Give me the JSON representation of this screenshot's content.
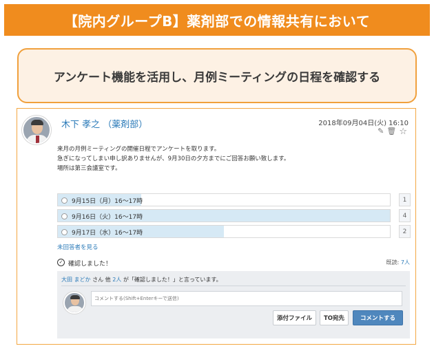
{
  "banner": {
    "title": "【院内グループB】薬剤部での情報共有において"
  },
  "subtitle": {
    "text": "アンケート機能を活用し、月例ミーティングの日程を確認する"
  },
  "post": {
    "author": "木下 孝之 （薬剤部）",
    "timestamp": "2018年09月04日(火) 16:10",
    "body_lines": [
      "来月の月例ミーティングの開催日程でアンケートを取ります。",
      "急ぎになってしまい申し訳ありませんが、9月30日の夕方までにご回答お願い致します。",
      "場所は第三会議室です。"
    ],
    "icons": [
      "edit-icon",
      "trash-icon",
      "star-icon"
    ],
    "tool_glyphs": {
      "edit": "✎",
      "trash": "🗑",
      "star": "☆"
    }
  },
  "poll": {
    "options": [
      {
        "label": "9月15日（月）16～17時",
        "count": "1",
        "share": 0.25
      },
      {
        "label": "9月16日（火）16～17時",
        "count": "4",
        "share": 1.0
      },
      {
        "label": "9月17日（水）16～17時",
        "count": "2",
        "share": 0.5
      }
    ],
    "unanswered_link": "未回答者を見る"
  },
  "confirm": {
    "check_glyph": "✓",
    "label": "確認しました！",
    "read_prefix": "既読:",
    "read_count": "7人"
  },
  "comments": {
    "liked_name": "大田 まどか",
    "liked_mid": " さん 他 ",
    "liked_count": "2人",
    "liked_suffix": " が「確認しました！」と言っています。",
    "input_placeholder": "コメントする(Shift+Enterキーで送信)",
    "attach_label": "添付ファイル",
    "to_label": "TO宛先",
    "submit_label": "コメントする"
  }
}
